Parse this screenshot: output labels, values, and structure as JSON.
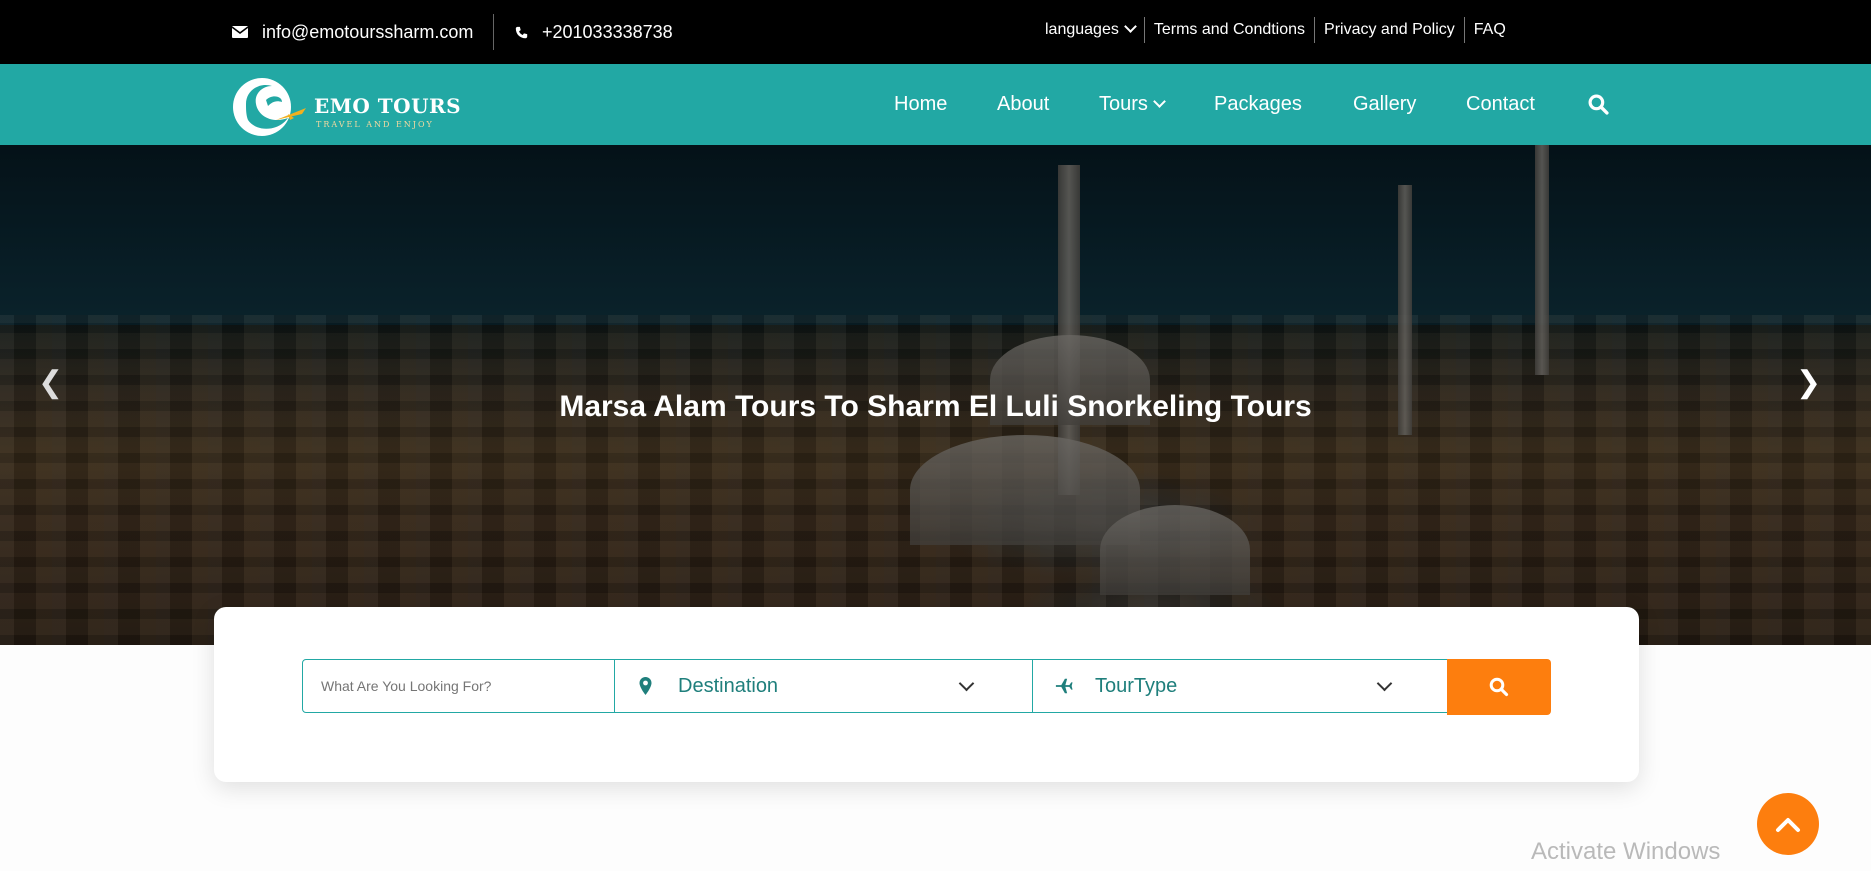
{
  "topbar": {
    "email": "info@emotourssharm.com",
    "phone": "+201033338738",
    "links": [
      "languages",
      "Terms and Condtions",
      "Privacy and Policy",
      "FAQ"
    ]
  },
  "brand": {
    "name": "EMO TOURS",
    "tagline": "TRAVEL AND ENJOY"
  },
  "nav": {
    "items": [
      "Home",
      "About",
      "Tours",
      "Packages",
      "Gallery",
      "Contact"
    ]
  },
  "hero": {
    "title": "Marsa Alam Tours To Sharm El Luli Snorkeling Tours",
    "prev_arrow": "❮",
    "next_arrow": "❯"
  },
  "search": {
    "placeholder": "What Are You Looking For?",
    "destination_label": "Destination",
    "tourtype_label": "TourType"
  },
  "overlay": {
    "watermark": "Activate Windows"
  },
  "colors": {
    "accent": "#22a8a4",
    "orange": "#fd7e0e",
    "topbar": "#000000"
  }
}
